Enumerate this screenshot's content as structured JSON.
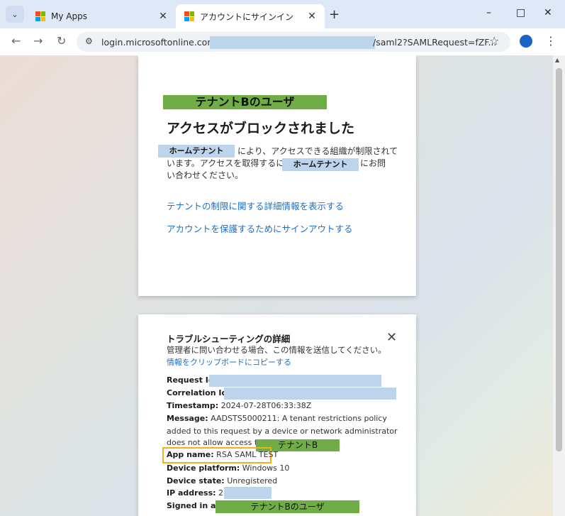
{
  "tabs": [
    {
      "title": "My Apps",
      "active": false
    },
    {
      "title": "アカウントにサインイン",
      "active": true
    }
  ],
  "browser": {
    "url_prefix": "login.microsoftonline.com/5",
    "url_suffix": "/saml2?SAMLRequest=fZF...",
    "accent": "#1a63c9"
  },
  "block_card": {
    "tenant_banner": "テナントBのユーザ",
    "heading": "アクセスがブロックされました",
    "home_tenant_label": "ホームテナント",
    "line1_text": "により、アクセスできる組織が制限されて",
    "line2_text": "います。アクセスを取得するには",
    "line2_suffix": "にお問",
    "line3_text": "い合わせください。",
    "link_details": "テナントの制限に関する詳細情報を表示する",
    "link_signout": "アカウントを保護するためにサインアウトする"
  },
  "troubleshoot": {
    "title": "トラブルシューティングの詳細",
    "subtitle": "管理者に問い合わせる場合、この情報を送信してください。",
    "copy_link": "情報をクリップボードにコピーする",
    "request_id_label": "Request Id:",
    "correlation_id_label": "Correlation Id:",
    "timestamp_label": "Timestamp:",
    "timestamp_value": "2024-07-28T06:33:38Z",
    "message_label": "Message:",
    "message_line1": "AADSTS5000211: A tenant restrictions policy",
    "message_line2": "added to this request by a device or network administrator",
    "message_line3": "does not allow access to",
    "message_tenant": "テナントB",
    "app_name_label": "App name:",
    "app_name_value": "RSA SAML TEST",
    "device_platform_label": "Device platform:",
    "device_platform_value": "Windows 10",
    "device_state_label": "Device state:",
    "device_state_value": "Unregistered",
    "ip_label": "IP address:",
    "ip_value": "217",
    "signed_in_label": "Signed in as:",
    "signed_in_value": "テナントBのユーザ"
  },
  "colors": {
    "highlight_green": "#70ad47",
    "redaction_blue": "#bcd4ec",
    "callout_orange": "#f0b21a",
    "link_blue": "#1f6fc5"
  }
}
